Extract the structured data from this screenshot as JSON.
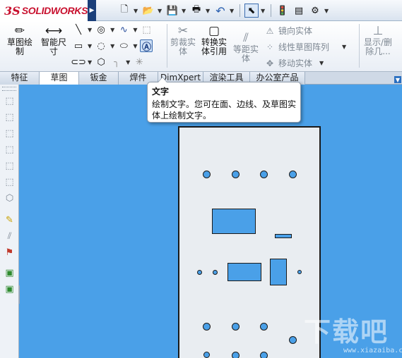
{
  "app": {
    "brand_ds": "3S",
    "brand_name": "SOLIDWORKS"
  },
  "quick_access": [
    {
      "name": "new-document-icon",
      "glyph": "🗋"
    },
    {
      "name": "open-folder-icon",
      "glyph": "📂"
    },
    {
      "name": "save-icon",
      "glyph": "💾"
    },
    {
      "name": "print-icon",
      "glyph": "🖶"
    },
    {
      "name": "undo-icon",
      "glyph": "↶"
    },
    {
      "name": "select-cursor-icon",
      "glyph": "⬉"
    },
    {
      "name": "traffic-light-icon",
      "glyph": "🚦"
    },
    {
      "name": "options-icon",
      "glyph": "▤"
    }
  ],
  "ribbon": {
    "sketch_label": "草图绘\n制",
    "smart_dim_label": "智能尺\n寸",
    "trim_label": "剪裁实\n体",
    "convert_label": "转换实\n体引用",
    "offset_label": "等距实\n体",
    "mirror_label": "镜向实体",
    "linear_pattern_label": "线性草图阵列",
    "move_label": "移动实体",
    "show_hide_label": "显示/删\n除几..."
  },
  "tabs": [
    "特征",
    "草图",
    "钣金",
    "焊件",
    "DimXpert",
    "渲染工具",
    "办公室产品"
  ],
  "active_tab_index": 1,
  "tooltip": {
    "title": "文字",
    "body": "绘制文字。您可在面、边线、及草图实体上绘制文字。"
  },
  "watermark": {
    "main": "下载吧",
    "sub": "www.xiazaiba.com"
  }
}
